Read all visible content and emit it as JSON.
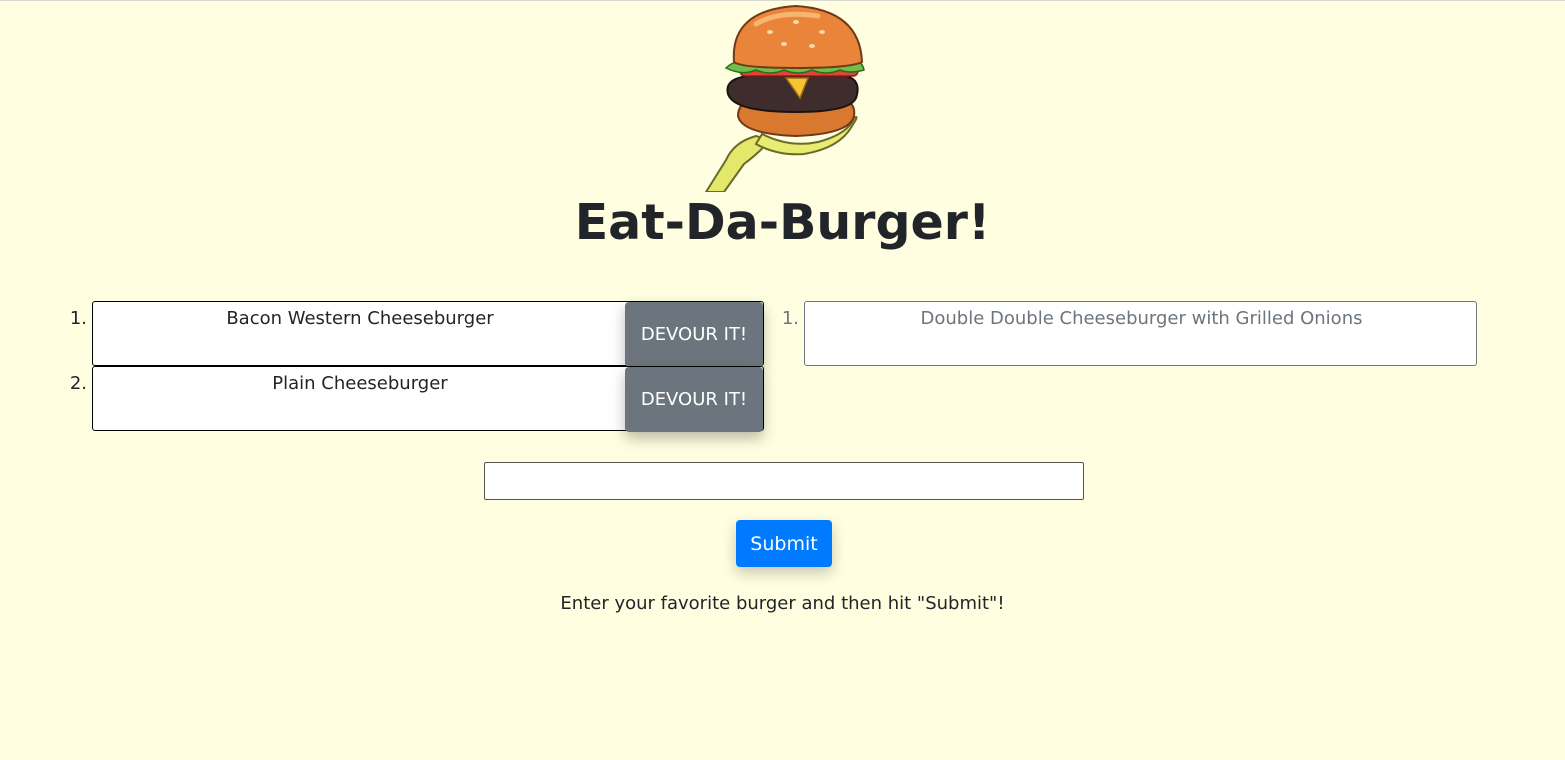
{
  "header": {
    "title": "Eat-Da-Burger!",
    "logo_icon": "burger-on-hand-icon"
  },
  "uneaten": [
    {
      "number": "1.",
      "name": "Bacon Western Cheeseburger",
      "button_label": "DEVOUR IT!"
    },
    {
      "number": "2.",
      "name": "Plain Cheeseburger",
      "button_label": "DEVOUR IT!"
    }
  ],
  "devoured": [
    {
      "number": "1.",
      "name": "Double Double Cheeseburger with Grilled Onions"
    }
  ],
  "form": {
    "input_value": "",
    "input_placeholder": "",
    "submit_label": "Submit",
    "instructions": "Enter your favorite burger and then hit \"Submit\"!"
  },
  "colors": {
    "background": "#fffee0",
    "devour_button": "#6c757d",
    "submit_button": "#007bff",
    "devoured_text": "#6c757d"
  }
}
